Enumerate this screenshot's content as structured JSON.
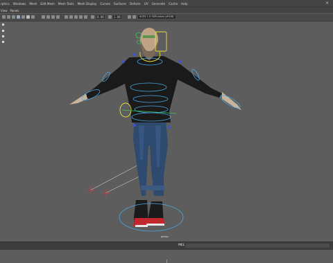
{
  "menubar": {
    "items": [
      "rphics",
      "Windows",
      "Mesh",
      "Edit Mesh",
      "Mesh Tools",
      "Mesh Display",
      "Curves",
      "Surfaces",
      "Deform",
      "UV",
      "Generate",
      "Cache",
      "Help"
    ]
  },
  "panel_menu": {
    "items": [
      "View",
      "Panels"
    ]
  },
  "toolbar": {
    "field_a": "0.00",
    "field_b": "1.00",
    "display_dropdown": "ACES 1.0 SDR-video (sRGB)"
  },
  "viewport": {
    "camera_label": "persp"
  },
  "statusbar": {
    "command_label": "MEL"
  },
  "colors": {
    "viewport_bg": "#5d5d5d",
    "rig_control": "#4aa8e8",
    "rig_selected": "#e8e23c",
    "ik_handle": "#d23a3a"
  },
  "icons": [
    "close-icon",
    "camera-icon",
    "grid-icon",
    "wireframe-icon",
    "shaded-icon",
    "texture-icon",
    "light-icon",
    "shadow-icon",
    "isolate-icon",
    "xray-icon"
  ]
}
